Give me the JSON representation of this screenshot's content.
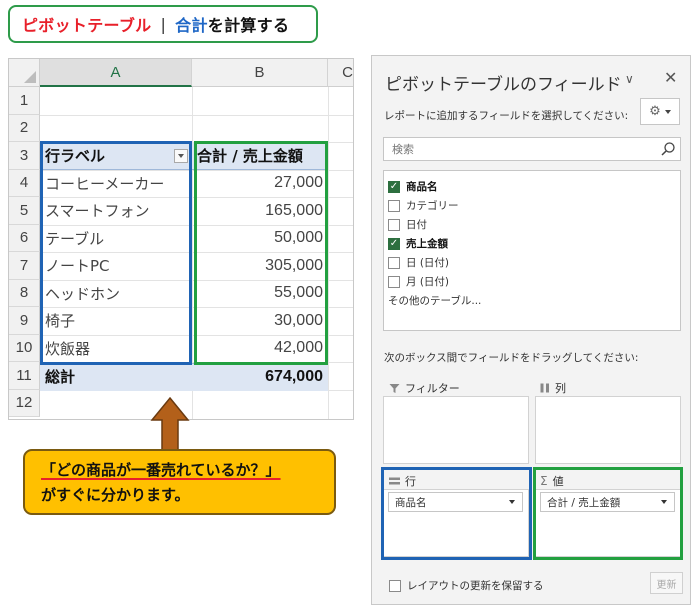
{
  "title": {
    "part1": "ピボットテーブル",
    "separator": "|",
    "part2_accent": "合計",
    "part2_rest": "を計算する",
    "colors": {
      "red": "#e8202a",
      "blue": "#1f67c6",
      "green_border": "#2e9b4a"
    }
  },
  "sheet": {
    "columns": [
      "A",
      "B",
      "C"
    ],
    "selected_column": "A",
    "row_numbers": [
      "1",
      "2",
      "3",
      "4",
      "5",
      "6",
      "7",
      "8",
      "9",
      "10",
      "11",
      "12"
    ],
    "pivot": {
      "row_label_header": "行ラベル",
      "value_header": "合計 / 売上金額",
      "rows": [
        {
          "label": "コーヒーメーカー",
          "value": "27,000"
        },
        {
          "label": "スマートフォン",
          "value": "165,000"
        },
        {
          "label": "テーブル",
          "value": "50,000"
        },
        {
          "label": "ノートPC",
          "value": "305,000"
        },
        {
          "label": "ヘッドホン",
          "value": "55,000"
        },
        {
          "label": "椅子",
          "value": "30,000"
        },
        {
          "label": "炊飯器",
          "value": "42,000"
        }
      ],
      "total_label": "総計",
      "total_value": "674,000"
    }
  },
  "callout": {
    "line1": "「どの商品が一番売れているか？」",
    "line2": "がすぐに分かります。",
    "color": "#ffc000"
  },
  "field_pane": {
    "title": "ピボットテーブルのフィールド",
    "instruction": "レポートに追加するフィールドを選択してください:",
    "search_placeholder": "検索",
    "fields": [
      {
        "name": "商品名",
        "checked": true
      },
      {
        "name": "カテゴリー",
        "checked": false
      },
      {
        "name": "日付",
        "checked": false
      },
      {
        "name": "売上金額",
        "checked": true
      },
      {
        "name": "日 (日付)",
        "checked": false
      },
      {
        "name": "月 (日付)",
        "checked": false
      }
    ],
    "more_tables": "その他のテーブル...",
    "drag_instruction": "次のボックス間でフィールドをドラッグしてください:",
    "areas": {
      "filter": {
        "label": "フィルター"
      },
      "columns": {
        "label": "列"
      },
      "rows": {
        "label": "行",
        "field": "商品名"
      },
      "values": {
        "label": "値",
        "field": "合計 / 売上金額"
      }
    },
    "defer_update_label": "レイアウトの更新を保留する",
    "update_button": "更新"
  }
}
